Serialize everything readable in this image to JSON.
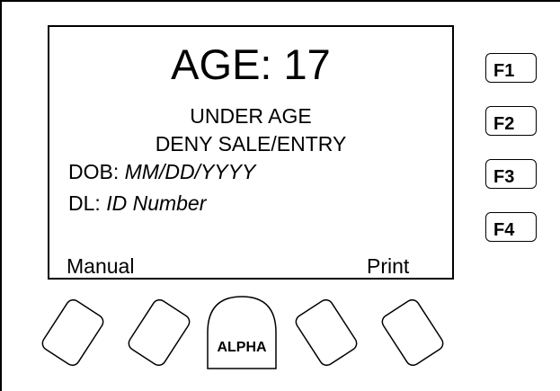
{
  "screen": {
    "age_line": "AGE: 17",
    "status_line": "UNDER AGE",
    "action_line": "DENY SALE/ENTRY",
    "dob_label": "DOB: ",
    "dob_value": "MM/DD/YYYY",
    "dl_label": "DL: ",
    "dl_value": "ID Number",
    "left_softkey_label": "Manual",
    "right_softkey_label": "Print"
  },
  "function_keys": [
    "F1",
    "F2",
    "F3",
    "F4"
  ],
  "center_key_label": "ALPHA"
}
